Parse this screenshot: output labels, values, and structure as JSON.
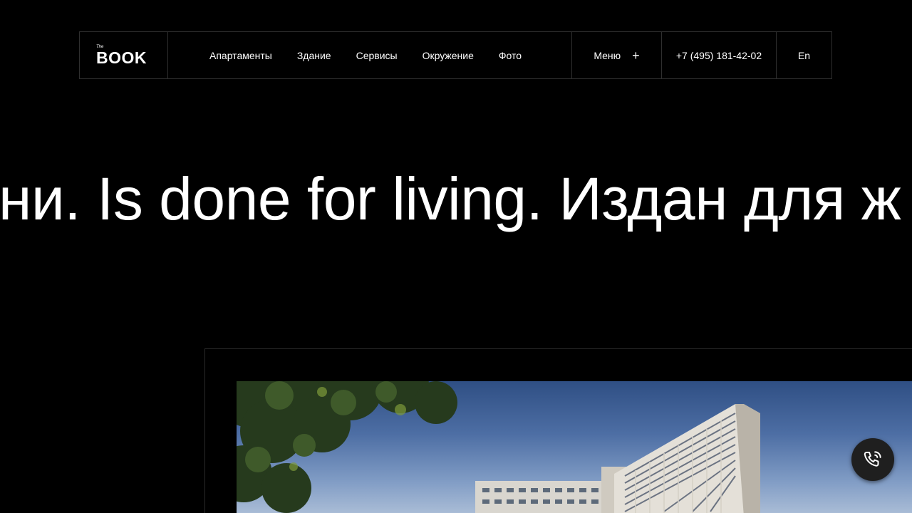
{
  "header": {
    "logo": {
      "the": "The",
      "book": "BOOK"
    },
    "nav_links": [
      "Апартаменты",
      "Здание",
      "Сервисы",
      "Окружение",
      "Фото"
    ],
    "menu_label": "Меню",
    "menu_icon": "plus-icon",
    "phone": "+7 (495) 181-42-02",
    "language": "En"
  },
  "hero": {
    "marquee_text": "ни. Is done for living. Издан для ж"
  },
  "visual": {
    "photo_icon": "building-photo",
    "call_icon": "phone-call-icon"
  },
  "colors": {
    "background": "#000000",
    "text": "#ffffff",
    "border": "#2f2f2f",
    "call_button": "#1f1f1f"
  }
}
